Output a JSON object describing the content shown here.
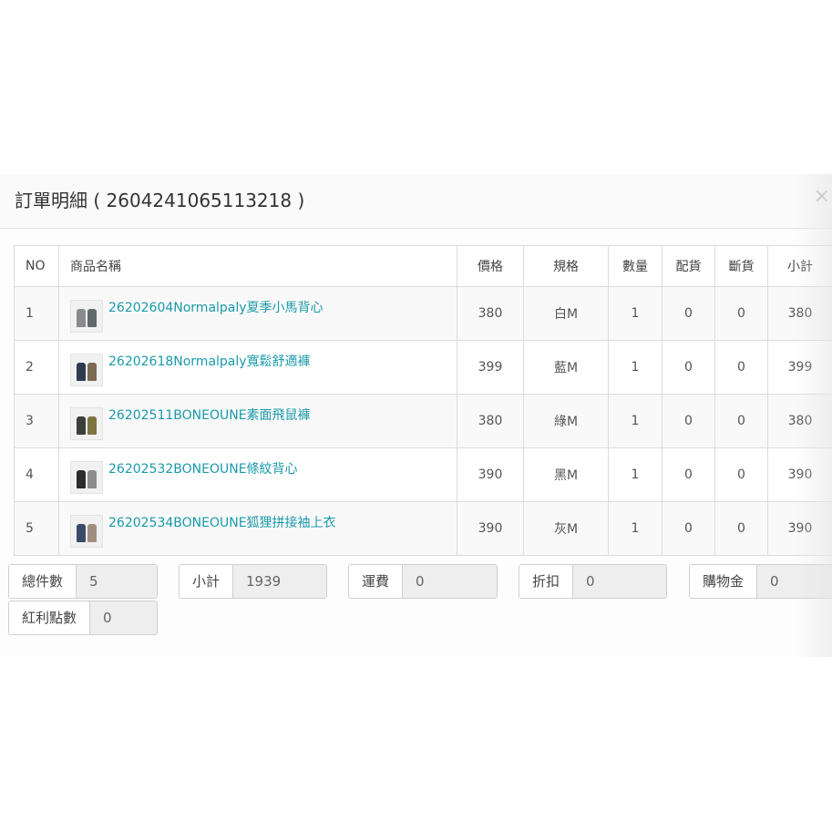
{
  "modal": {
    "title": "訂單明細 ( 2604241065113218 )",
    "close_label": "×"
  },
  "table": {
    "headers": [
      "NO",
      "商品名稱",
      "價格",
      "規格",
      "數量",
      "配貨",
      "斷貨",
      "小計"
    ],
    "rows": [
      {
        "no": "1",
        "name": "26202604Normalpaly夏季小馬背心",
        "price": "380",
        "spec": "白M",
        "qty": "1",
        "alloc": "0",
        "out": "0",
        "subtotal": "380"
      },
      {
        "no": "2",
        "name": "26202618Normalpaly寬鬆舒適褲",
        "price": "399",
        "spec": "藍M",
        "qty": "1",
        "alloc": "0",
        "out": "0",
        "subtotal": "399"
      },
      {
        "no": "3",
        "name": "26202511BONEOUNE素面飛鼠褲",
        "price": "380",
        "spec": "綠M",
        "qty": "1",
        "alloc": "0",
        "out": "0",
        "subtotal": "380"
      },
      {
        "no": "4",
        "name": "26202532BONEOUNE條紋背心",
        "price": "390",
        "spec": "黑M",
        "qty": "1",
        "alloc": "0",
        "out": "0",
        "subtotal": "390"
      },
      {
        "no": "5",
        "name": "26202534BONEOUNE狐狸拼接袖上衣",
        "price": "390",
        "spec": "灰M",
        "qty": "1",
        "alloc": "0",
        "out": "0",
        "subtotal": "390"
      }
    ]
  },
  "summary": {
    "total_items": {
      "label": "總件數",
      "value": "5"
    },
    "subtotal": {
      "label": "小計",
      "value": "1939"
    },
    "shipping": {
      "label": "運費",
      "value": "0"
    },
    "discount": {
      "label": "折扣",
      "value": "0"
    },
    "shopping_credit": {
      "label": "購物金",
      "value": "0"
    },
    "bonus_points": {
      "label": "紅利點數",
      "value": "0"
    }
  },
  "colors": {
    "link": "#1a9aaa",
    "border": "#dcdcdc",
    "readonly_bg": "#eeeeee"
  },
  "thumbnails": [
    {
      "icon": "product-thumbnail-vests",
      "c1": "#8a8a8a",
      "c2": "#5f6a6a"
    },
    {
      "icon": "product-thumbnail-pants",
      "c1": "#2d3b4f",
      "c2": "#7a6b52"
    },
    {
      "icon": "product-thumbnail-pants",
      "c1": "#3a3f3a",
      "c2": "#7d7440"
    },
    {
      "icon": "product-thumbnail-vests",
      "c1": "#2b2b2b",
      "c2": "#8c8c8c"
    },
    {
      "icon": "product-thumbnail-shirts",
      "c1": "#3c4a6a",
      "c2": "#a08f80"
    }
  ]
}
